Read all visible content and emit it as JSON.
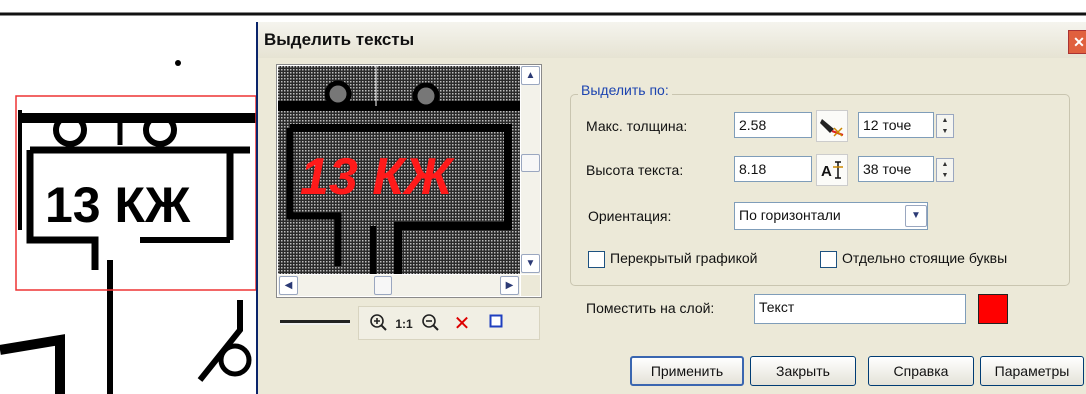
{
  "dialog": {
    "title": "Выделить тексты",
    "close_label": "✕"
  },
  "preview": {
    "text": "13 КЖ"
  },
  "background_scan": {
    "text": "13 КЖ"
  },
  "toolbar": {
    "zoom_in_icon": "zoom-in-icon",
    "one_to_one_label": "1:1",
    "zoom_out_icon": "zoom-out-icon",
    "delete_icon": "delete-icon",
    "frame_icon": "frame-icon"
  },
  "select_by": {
    "legend": "Выделить по:",
    "max_thickness": {
      "label": "Макс. толщина:",
      "value": "2.58",
      "points_value": "12 точе"
    },
    "text_height": {
      "label": "Высота текста:",
      "value": "8.18",
      "points_value": "38 точе"
    },
    "orientation": {
      "label": "Ориентация:",
      "selected": "По горизонтали"
    },
    "overlapped_checkbox": {
      "label": "Перекрытый графикой",
      "checked": false
    },
    "separate_letters_checkbox": {
      "label": "Отдельно стоящие буквы",
      "checked": false
    }
  },
  "layer": {
    "label": "Поместить на слой:",
    "value": "Текст",
    "color": "#ff0000"
  },
  "buttons": {
    "apply": "Применить",
    "close": "Закрыть",
    "help": "Справка",
    "params": "Параметры"
  },
  "colors": {
    "accent": "#1c44b0",
    "text_highlight": "#ff0000"
  }
}
